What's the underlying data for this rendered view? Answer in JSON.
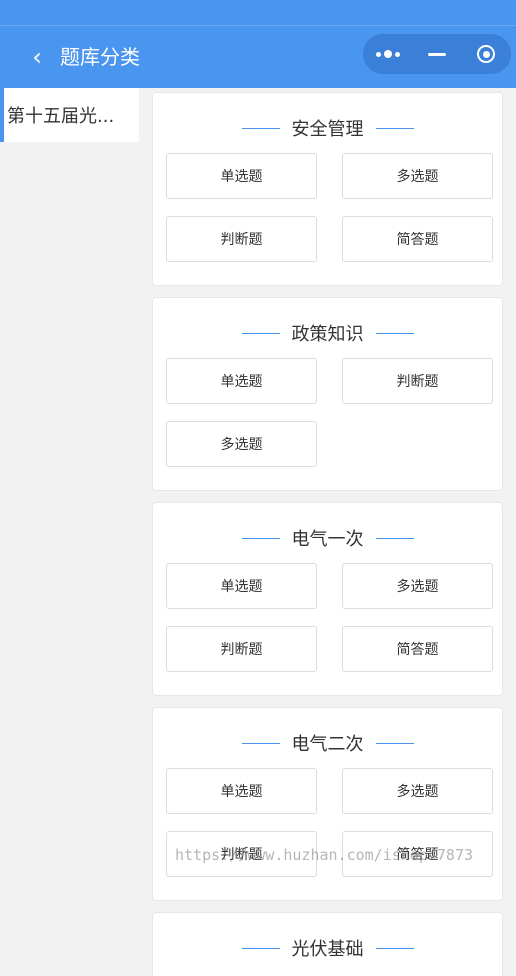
{
  "nav": {
    "back_icon": "chevron-left-icon",
    "title": "题库分类",
    "capsule_icons": [
      "more-dots-icon",
      "minimize-icon",
      "target-icon"
    ]
  },
  "sidebar": {
    "items": [
      {
        "label": "第十五届光..."
      }
    ]
  },
  "categories": [
    {
      "title": "安全管理",
      "buttons": [
        "单选题",
        "多选题",
        "判断题",
        "简答题"
      ]
    },
    {
      "title": "政策知识",
      "buttons": [
        "单选题",
        "判断题",
        "多选题"
      ]
    },
    {
      "title": "电气一次",
      "buttons": [
        "单选题",
        "多选题",
        "判断题",
        "简答题"
      ]
    },
    {
      "title": "电气二次",
      "buttons": [
        "单选题",
        "多选题",
        "判断题",
        "简答题"
      ]
    },
    {
      "title": "光伏基础",
      "buttons": []
    }
  ],
  "watermark": "https://www.huzhan.com/ishop47873",
  "colors": {
    "accent": "#4a95ef",
    "capsule": "#3a7fd8",
    "background": "#f2f2f2"
  }
}
